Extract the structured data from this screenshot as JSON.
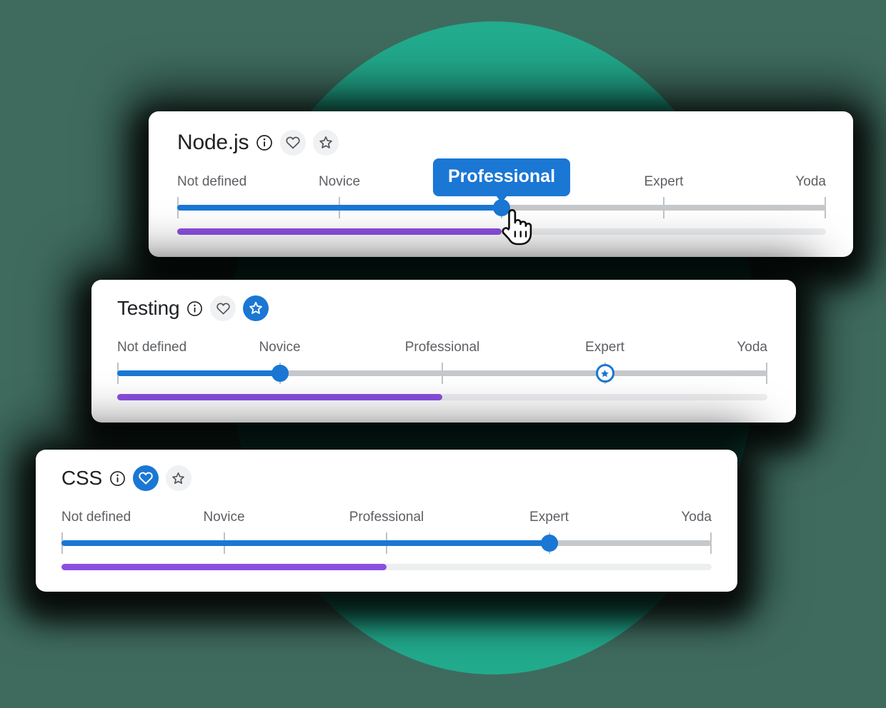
{
  "theme": {
    "background": "#3f6b5e",
    "blob_color": "#22ab8d",
    "accent_blue": "#1a77d4",
    "accent_purple": "#8b4fe0",
    "track_gray": "#c6c9cc",
    "subtrack_gray": "#eceef0",
    "card_bg": "#ffffff",
    "label_color": "#5c5f63",
    "title_color": "#1f2124"
  },
  "scale": {
    "levels": [
      "Not defined",
      "Novice",
      "Professional",
      "Expert",
      "Yoda"
    ],
    "positions_pct": [
      0,
      25,
      50,
      75,
      100
    ]
  },
  "icons": {
    "info": "info-icon",
    "heart": "heart-icon",
    "star": "star-icon",
    "cursor": "pointer-hand-cursor"
  },
  "cards": [
    {
      "id": "nodejs",
      "name": "Node.js",
      "info_label": "info-icon",
      "heart": {
        "label": "heart-icon",
        "active": false
      },
      "star": {
        "label": "star-icon",
        "active": false
      },
      "level_value_pct": 50,
      "level_label": "Professional",
      "goal_pct": null,
      "goal_label": null,
      "secondary_value_pct": 50,
      "tooltip": {
        "visible": true,
        "text": "Professional",
        "at_pct": 50
      },
      "cursor": {
        "visible": true,
        "at_pct": 50
      }
    },
    {
      "id": "testing",
      "name": "Testing",
      "info_label": "info-icon",
      "heart": {
        "label": "heart-icon",
        "active": false
      },
      "star": {
        "label": "star-icon",
        "active": true
      },
      "level_value_pct": 25,
      "level_label": "Novice",
      "goal_pct": 75,
      "goal_label": "Expert",
      "secondary_value_pct": 50,
      "tooltip": {
        "visible": false,
        "text": "",
        "at_pct": 25
      },
      "cursor": {
        "visible": false,
        "at_pct": 0
      }
    },
    {
      "id": "css",
      "name": "CSS",
      "info_label": "info-icon",
      "heart": {
        "label": "heart-icon",
        "active": true
      },
      "star": {
        "label": "star-icon",
        "active": false
      },
      "level_value_pct": 75,
      "level_label": "Expert",
      "goal_pct": null,
      "goal_label": null,
      "secondary_value_pct": 50,
      "tooltip": {
        "visible": false,
        "text": "",
        "at_pct": 75
      },
      "cursor": {
        "visible": false,
        "at_pct": 0
      }
    }
  ]
}
